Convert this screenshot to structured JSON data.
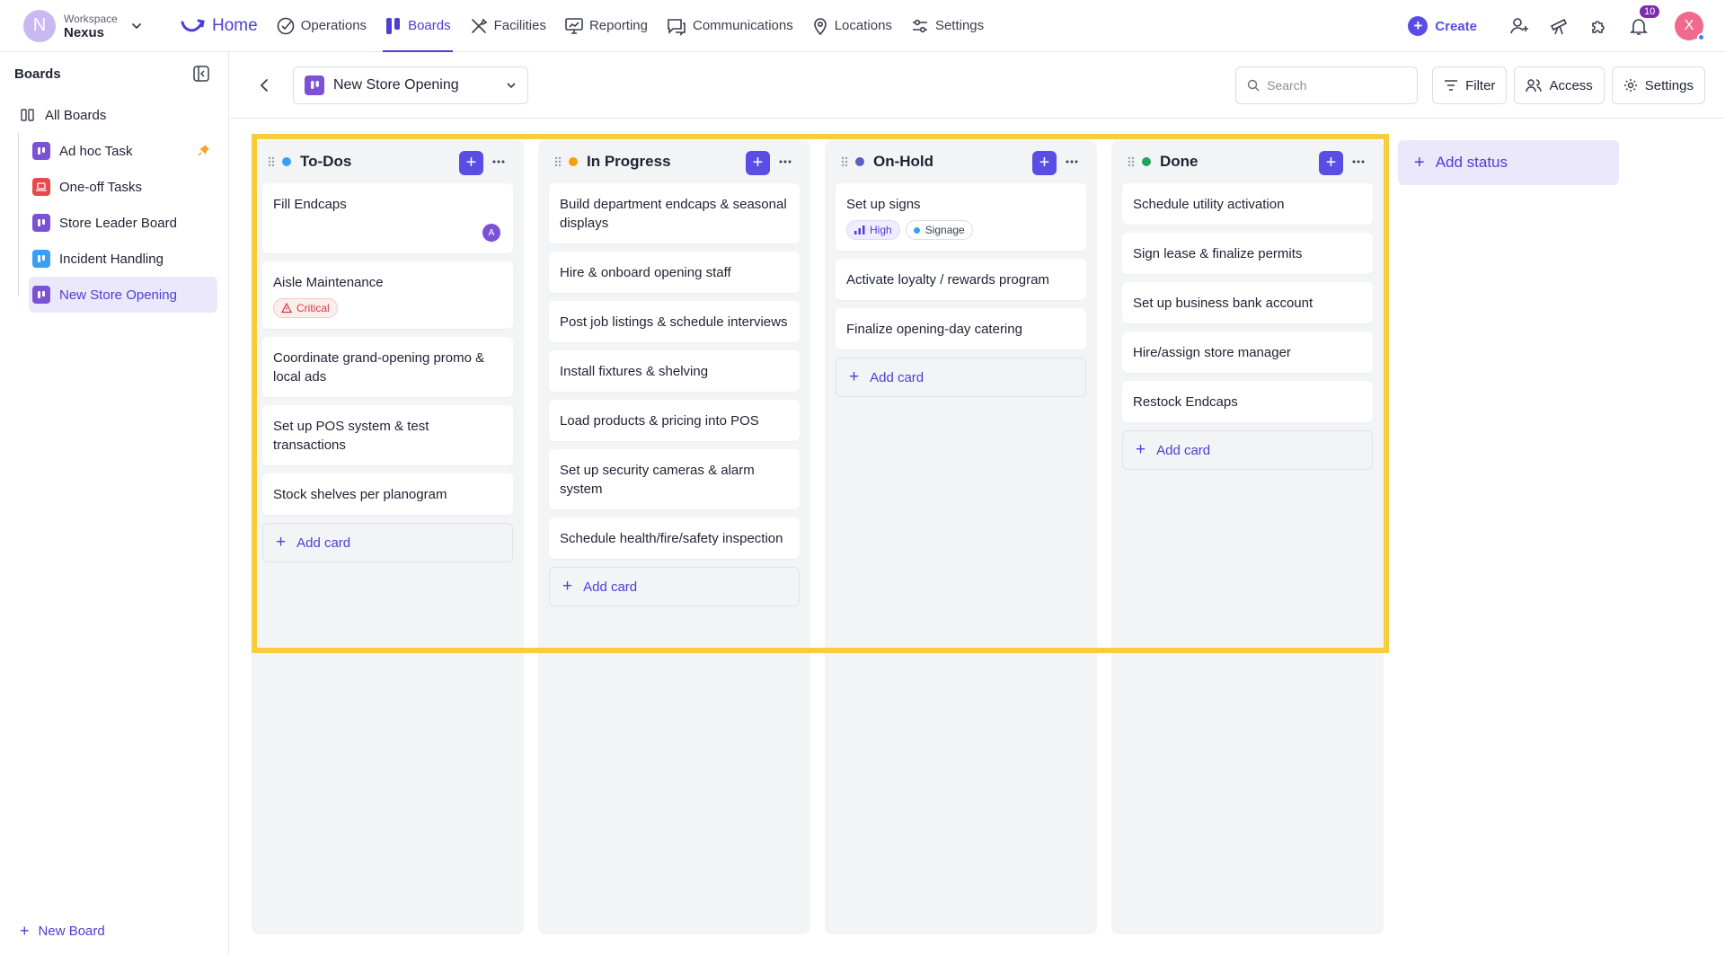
{
  "workspace": {
    "initial": "N",
    "label": "Workspace",
    "name": "Nexus"
  },
  "nav": {
    "home": "Home",
    "items": [
      "Operations",
      "Boards",
      "Facilities",
      "Reporting",
      "Communications",
      "Locations",
      "Settings"
    ],
    "active": "Boards"
  },
  "topright": {
    "create": "Create",
    "notifications_count": "10",
    "user_initial": "X"
  },
  "sidebar": {
    "title": "Boards",
    "all_boards": "All Boards",
    "boards": [
      {
        "label": "Ad hoc Task",
        "color": "#7b52d6",
        "pinned": true
      },
      {
        "label": "One-off Tasks",
        "color": "#e5484d"
      },
      {
        "label": "Store Leader Board",
        "color": "#7b52d6"
      },
      {
        "label": "Incident Handling",
        "color": "#3b9ef5"
      },
      {
        "label": "New Store Opening",
        "color": "#7b52d6",
        "active": true
      }
    ],
    "new_board": "New Board"
  },
  "header": {
    "board_name": "New Store Opening",
    "search_placeholder": "Search",
    "filter": "Filter",
    "access": "Access",
    "settings": "Settings"
  },
  "columns": [
    {
      "title": "To-Dos",
      "color": "#3b9ef5",
      "cards": [
        {
          "title": "Fill Endcaps",
          "assignee": "A"
        },
        {
          "title": "Aisle Maintenance",
          "chip": "Critical"
        },
        {
          "title": "Coordinate grand-opening promo & local ads"
        },
        {
          "title": "Set up POS system & test transactions"
        },
        {
          "title": "Stock shelves per planogram"
        }
      ],
      "add_card": "Add card"
    },
    {
      "title": "In Progress",
      "color": "#f59e0b",
      "cards": [
        {
          "title": "Build department endcaps & seasonal displays"
        },
        {
          "title": "Hire & onboard opening staff"
        },
        {
          "title": "Post job listings & schedule interviews"
        },
        {
          "title": "Install fixtures & shelving"
        },
        {
          "title": "Load products & pricing into POS"
        },
        {
          "title": "Set up security cameras & alarm system"
        },
        {
          "title": "Schedule health/fire/safety inspection"
        }
      ],
      "add_card": "Add card"
    },
    {
      "title": "On-Hold",
      "color": "#5b5fc7",
      "cards": [
        {
          "title": "Set up signs",
          "priority": "High",
          "tag": "Signage"
        },
        {
          "title": "Activate loyalty / rewards program"
        },
        {
          "title": "Finalize opening-day catering"
        }
      ],
      "add_card": "Add card"
    },
    {
      "title": "Done",
      "color": "#22a55a",
      "cards": [
        {
          "title": "Schedule utility activation"
        },
        {
          "title": "Sign lease & finalize permits"
        },
        {
          "title": "Set up business bank account"
        },
        {
          "title": "Hire/assign store manager"
        },
        {
          "title": "Restock Endcaps"
        }
      ],
      "add_card": "Add card"
    }
  ],
  "add_status": "Add status"
}
